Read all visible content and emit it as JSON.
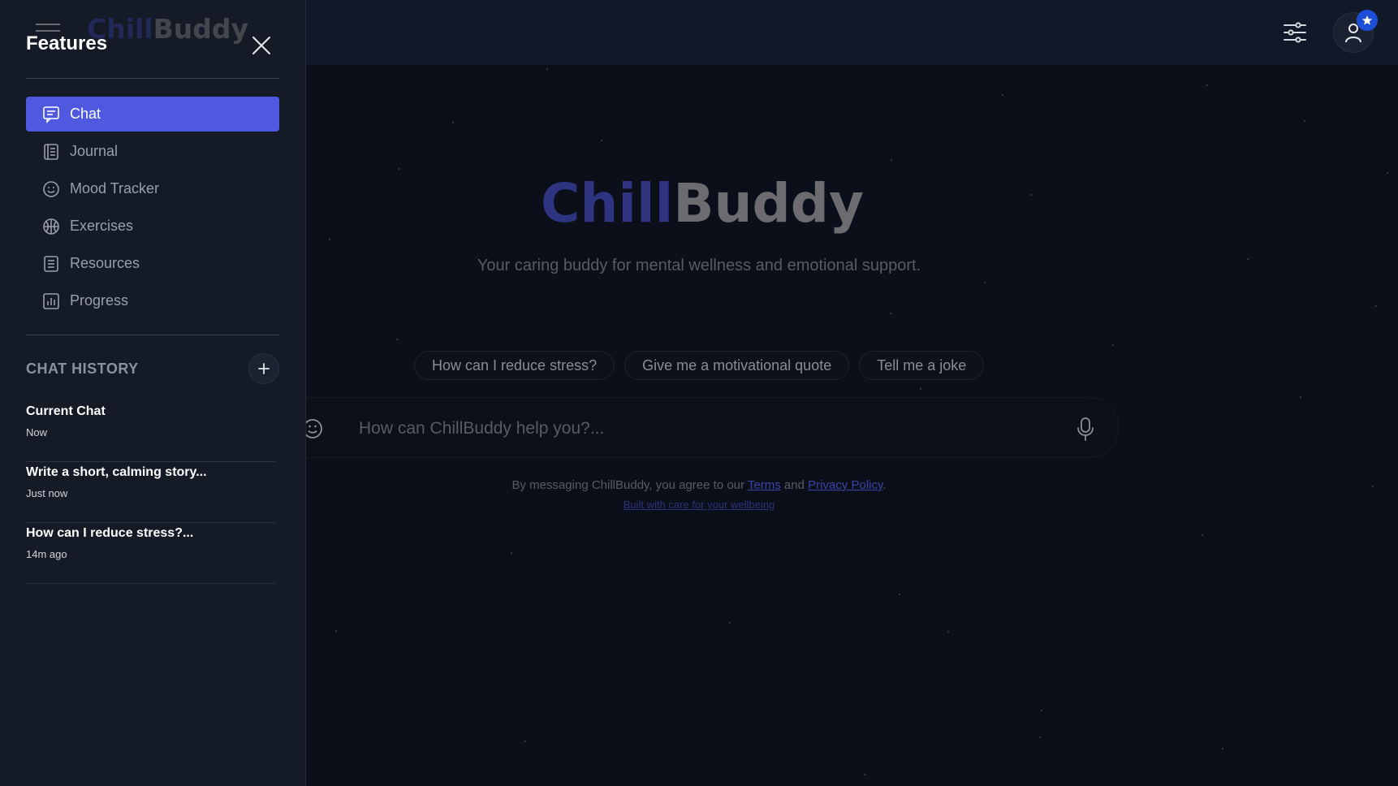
{
  "sidebar": {
    "title": "Features",
    "logo": {
      "part1": "Chill",
      "part2": "Buddy"
    },
    "nav": [
      {
        "label": "Chat",
        "icon": "chat-icon",
        "active": true
      },
      {
        "label": "Journal",
        "icon": "journal-icon",
        "active": false
      },
      {
        "label": "Mood Tracker",
        "icon": "smiley-icon",
        "active": false
      },
      {
        "label": "Exercises",
        "icon": "exercise-icon",
        "active": false
      },
      {
        "label": "Resources",
        "icon": "resources-icon",
        "active": false
      },
      {
        "label": "Progress",
        "icon": "progress-chart-icon",
        "active": false
      }
    ],
    "history_heading": "CHAT HISTORY",
    "history": [
      {
        "title": "Current Chat",
        "time": "Now"
      },
      {
        "title": "Write a short, calming story...",
        "time": "Just now"
      },
      {
        "title": "How can I reduce stress?...",
        "time": "14m ago"
      }
    ]
  },
  "main": {
    "logo": {
      "part1": "Chill",
      "part2": "Buddy"
    },
    "tagline": "Your caring buddy for mental wellness and emotional support.",
    "suggestions": [
      "How can I reduce stress?",
      "Give me a motivational quote",
      "Tell me a joke"
    ],
    "input_placeholder": "How can ChillBuddy help you?...",
    "legal_prefix": "By messaging ChillBuddy, you agree to our",
    "terms_link": "Terms",
    "legal_and": "and",
    "privacy_link": "Privacy Policy",
    "legal_suffix": ".",
    "built_with": "Built with care for your wellbeing"
  },
  "colors": {
    "accent": "#4f59e0",
    "background": "#0a0f1a",
    "sidebar": "#141a26",
    "badge": "#1d4ed8"
  }
}
